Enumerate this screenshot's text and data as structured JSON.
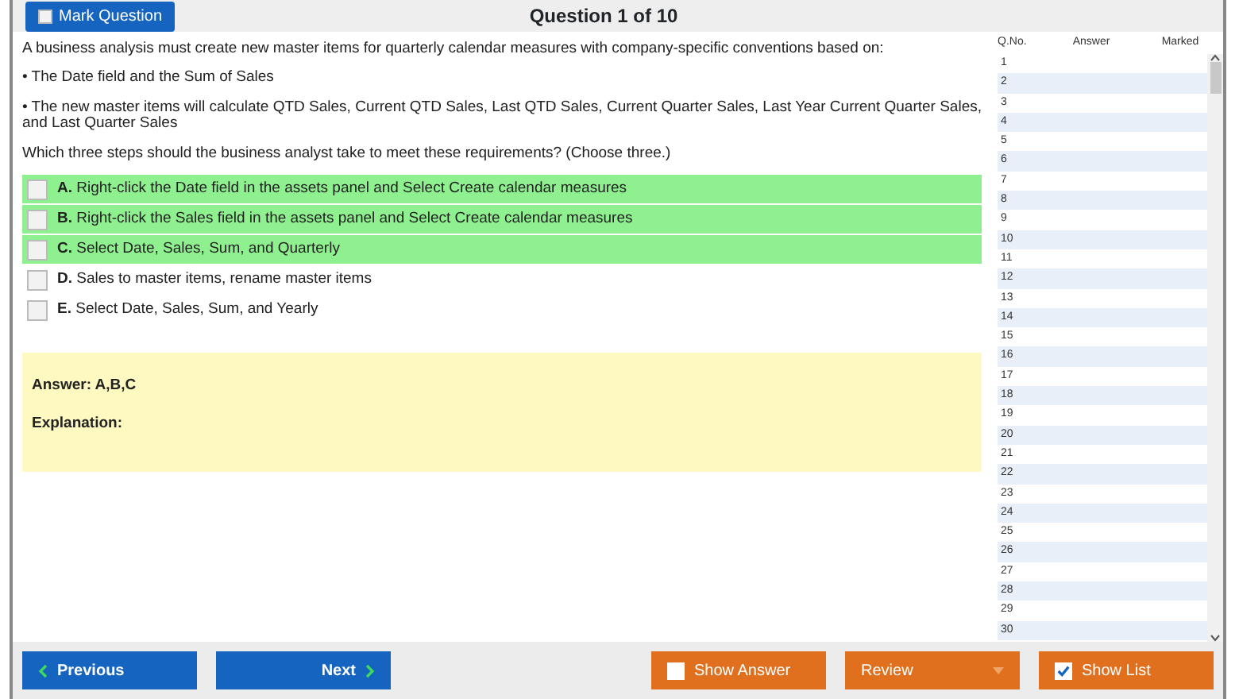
{
  "header": {
    "mark_button": {
      "label": "Mark Question",
      "checked": false
    },
    "title": "Question 1 of 10"
  },
  "question": {
    "paragraphs": [
      "A business analysis must create new master items for quarterly calendar measures with company-specific conventions based on:",
      "• The Date field and the Sum of Sales",
      "• The new master items will calculate QTD Sales, Current QTD Sales, Last QTD Sales, Current Quarter Sales, Last Year Current Quarter Sales, and Last Quarter Sales",
      "Which three steps should the business analyst take to meet these requirements? (Choose three.)"
    ]
  },
  "options": [
    {
      "letter": "A.",
      "text": "Right-click the Date field in the assets panel and Select Create calendar measures",
      "highlighted": true,
      "checked": false
    },
    {
      "letter": "B.",
      "text": "Right-click the Sales field in the assets panel and Select Create calendar measures",
      "highlighted": true,
      "checked": false
    },
    {
      "letter": "C.",
      "text": "Select Date, Sales, Sum, and Quarterly",
      "highlighted": true,
      "checked": false
    },
    {
      "letter": "D.",
      "text": "Sales to master items, rename master items",
      "highlighted": false,
      "checked": false
    },
    {
      "letter": "E.",
      "text": "Select Date, Sales, Sum, and Yearly",
      "highlighted": false,
      "checked": false
    }
  ],
  "answer_box": {
    "answer": "Answer: A,B,C",
    "explanation": "Explanation:"
  },
  "question_list": {
    "columns": [
      "Q.No.",
      "Answer",
      "Marked"
    ],
    "rows": [
      "1",
      "2",
      "3",
      "4",
      "5",
      "6",
      "7",
      "8",
      "9",
      "10",
      "11",
      "12",
      "13",
      "14",
      "15",
      "16",
      "17",
      "18",
      "19",
      "20",
      "21",
      "22",
      "23",
      "24",
      "25",
      "26",
      "27",
      "28",
      "29",
      "30"
    ]
  },
  "footer": [
    {
      "kind": "previous",
      "label": "Previous"
    },
    {
      "kind": "next",
      "label": "Next"
    },
    {
      "kind": "checkbox",
      "label": "Show Answer",
      "checked": false
    },
    {
      "kind": "dropdown",
      "label": "Review"
    },
    {
      "kind": "checkbox",
      "label": "Show List",
      "checked": true
    }
  ]
}
